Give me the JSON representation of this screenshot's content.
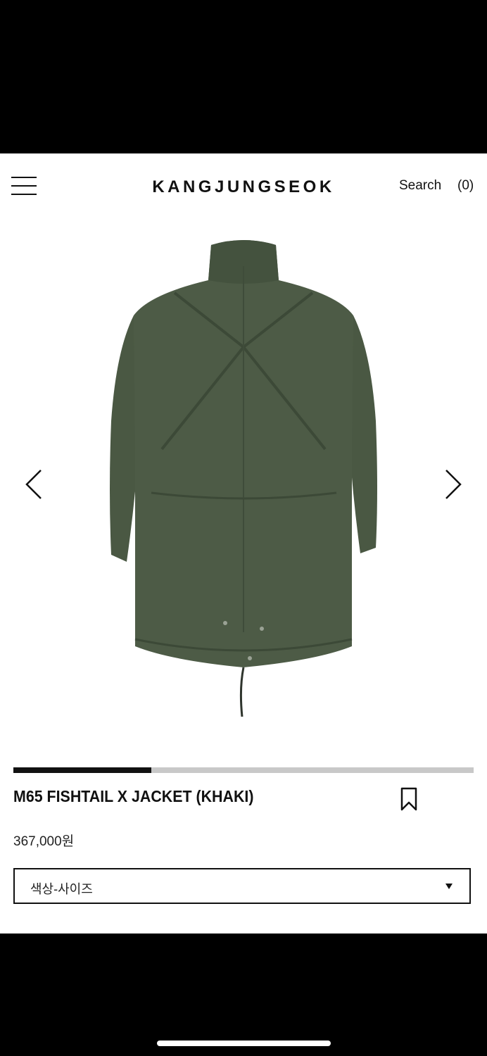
{
  "header": {
    "brand": "KANGJUNGSEOK",
    "search_label": "Search",
    "cart_count": "(0)",
    "menu_icon": "hamburger-menu-icon"
  },
  "gallery": {
    "image_subject": "khaki fishtail parka jacket, back view",
    "prev_icon": "chevron-left-icon",
    "next_icon": "chevron-right-icon",
    "progress_fraction": 0.3
  },
  "product": {
    "title": "M65 FISHTAIL X JACKET (KHAKI)",
    "price": "367,000원",
    "bookmark_icon": "bookmark-icon",
    "option_select": {
      "selected": "색상-사이즈",
      "caret_icon": "caret-down-icon"
    }
  },
  "colors": {
    "jacket_khaki": "#4c5a45",
    "accent": "#111111",
    "progress_track": "#c8c8c8"
  }
}
